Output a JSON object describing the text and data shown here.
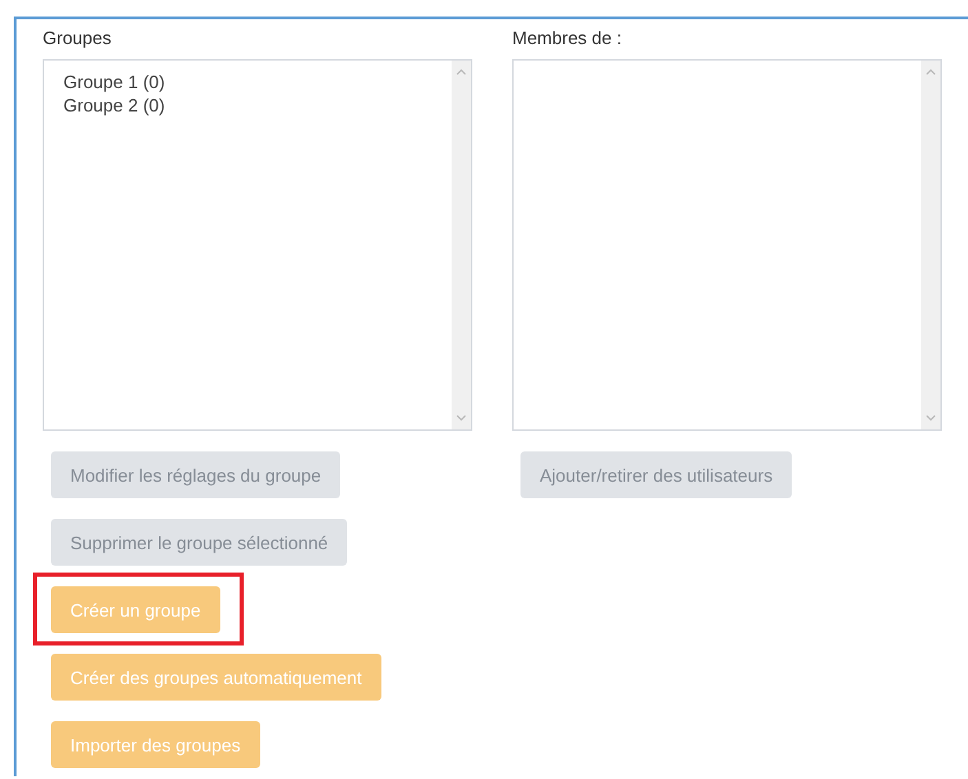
{
  "groups_panel": {
    "label": "Groupes",
    "items": [
      {
        "label": "Groupe 1 (0)",
        "selected": false
      },
      {
        "label": "Groupe 2 (0)",
        "selected": false
      }
    ]
  },
  "members_panel": {
    "label": "Membres de :"
  },
  "member_buttons": [
    {
      "label": "Ajouter/retirer des utilisateurs",
      "disabled": true,
      "highlighted": false
    }
  ],
  "group_buttons": [
    {
      "label": "Modifier les réglages du groupe",
      "disabled": true,
      "highlighted": false
    },
    {
      "label": "Supprimer le groupe sélectionné",
      "disabled": true,
      "highlighted": false
    },
    {
      "label": "Créer un groupe",
      "disabled": false,
      "highlighted": true
    },
    {
      "label": "Créer des groupes automatiquement",
      "disabled": false,
      "highlighted": false
    },
    {
      "label": "Importer des groupes",
      "disabled": false,
      "highlighted": false
    }
  ]
}
